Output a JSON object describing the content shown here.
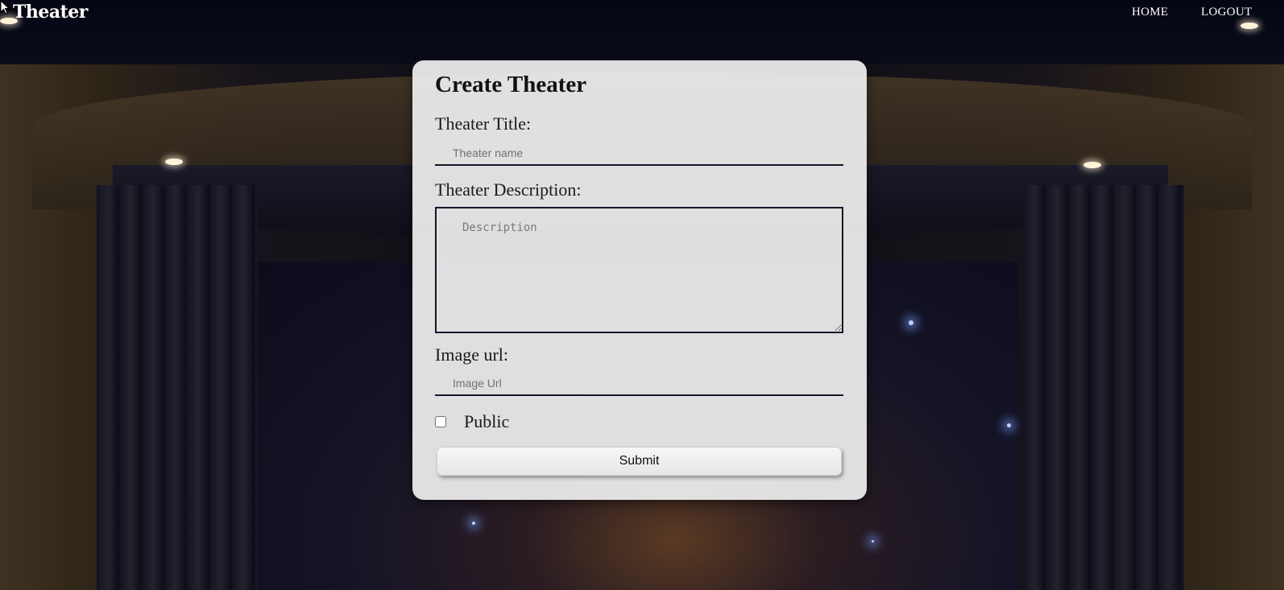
{
  "nav": {
    "brand": "Theater",
    "links": [
      "HOME",
      "LOGOUT"
    ]
  },
  "form": {
    "title": "Create Theater",
    "title_label": "Theater Title:",
    "title_placeholder": "Theater name",
    "description_label": "Theater Description:",
    "description_placeholder": "Description",
    "image_label": "Image url:",
    "image_placeholder": "Image Url",
    "public_label": "Public",
    "public_checked": false,
    "submit_label": "Submit"
  },
  "colors": {
    "card_bg": "#ececec",
    "nav_text": "#ffffff",
    "input_border": "#151528"
  }
}
